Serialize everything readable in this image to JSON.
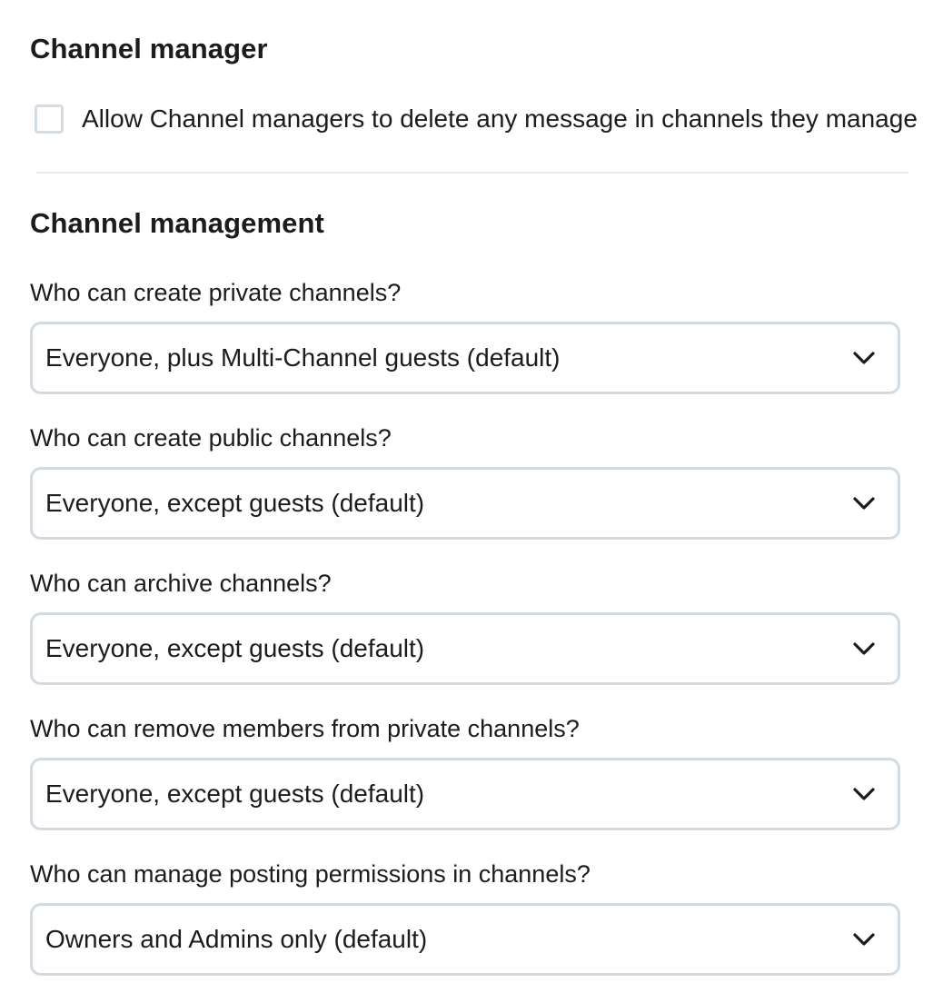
{
  "channel_manager": {
    "title": "Channel manager",
    "checkbox_label": "Allow Channel managers to delete any message in channels they manage",
    "checked": false
  },
  "channel_management": {
    "title": "Channel management",
    "fields": [
      {
        "label": "Who can create private channels?",
        "value": "Everyone, plus Multi-Channel guests (default)"
      },
      {
        "label": "Who can create public channels?",
        "value": "Everyone, except guests (default)"
      },
      {
        "label": "Who can archive channels?",
        "value": "Everyone, except guests (default)"
      },
      {
        "label": "Who can remove members from private channels?",
        "value": "Everyone, except guests (default)"
      },
      {
        "label": "Who can manage posting permissions in channels?",
        "value": "Owners and Admins only (default)"
      }
    ]
  },
  "icons": {
    "dropdown": "chevron-down-icon"
  }
}
